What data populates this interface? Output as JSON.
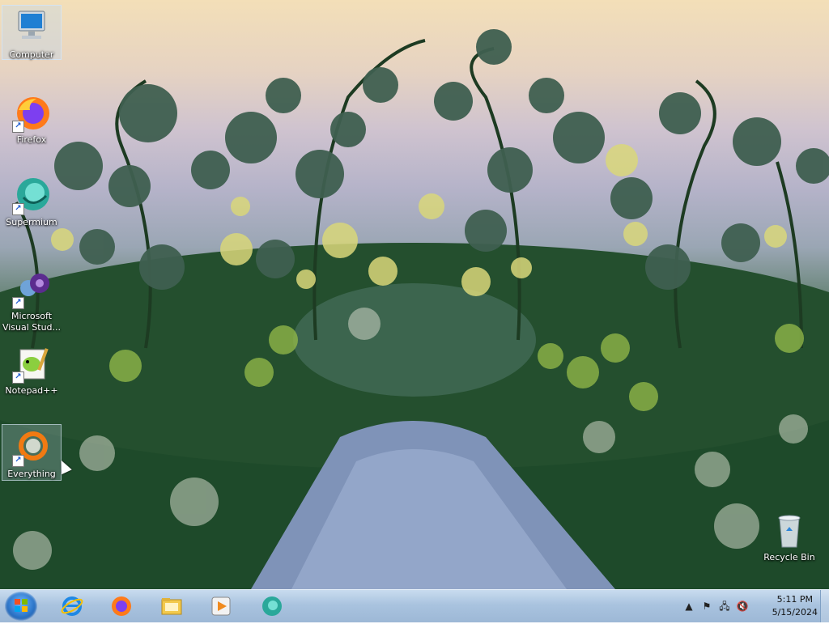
{
  "desktop": {
    "icons": [
      {
        "label": "Computer"
      },
      {
        "label": "Firefox"
      },
      {
        "label": "Supermium"
      },
      {
        "label": "Microsoft Visual Stud..."
      },
      {
        "label": "Notepad++"
      },
      {
        "label": "Everything"
      },
      {
        "label": "Recycle Bin"
      }
    ]
  },
  "taskbar": {
    "start_icon": "windows-start-orb",
    "pinned": [
      {
        "name": "internet-explorer-icon"
      },
      {
        "name": "firefox-icon"
      },
      {
        "name": "file-explorer-icon"
      },
      {
        "name": "media-player-icon"
      },
      {
        "name": "supermium-icon"
      }
    ]
  },
  "tray": {
    "time": "5:11 PM",
    "date": "5/15/2024",
    "icons": [
      "show-hidden-icons",
      "action-center-flag-icon",
      "network-icon",
      "volume-muted-icon"
    ]
  }
}
